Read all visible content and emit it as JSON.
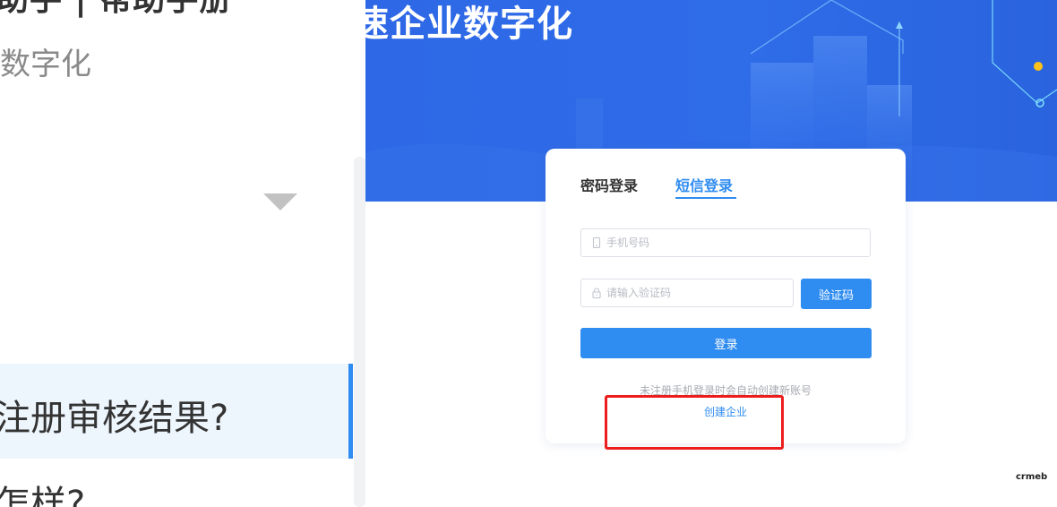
{
  "help_doc": {
    "title": "助手 | 帮助手册",
    "subtitle": "数字化",
    "active_question": "注册审核结果?",
    "next_question": "怎样?"
  },
  "banner": {
    "title": "速企业数字化"
  },
  "login": {
    "tabs": [
      {
        "label": "密码登录",
        "active": false
      },
      {
        "label": "短信登录",
        "active": true
      }
    ],
    "phone_placeholder": "手机号码",
    "code_placeholder": "请输入验证码",
    "get_code_label": "验证码",
    "submit_label": "登录",
    "hint": "未注册手机登录时会自动创建新账号",
    "create_link": "创建企业"
  },
  "brand": {
    "logo_text": "crmeb"
  },
  "colors": {
    "primary": "#2f8cf0",
    "banner": "#2e68e6",
    "highlight": "#ee1d1d",
    "active_row_bg": "#eef6fd"
  },
  "icons": {
    "phone_field": "phone-icon",
    "code_field": "lock-icon",
    "collapse": "caret-down-icon"
  }
}
